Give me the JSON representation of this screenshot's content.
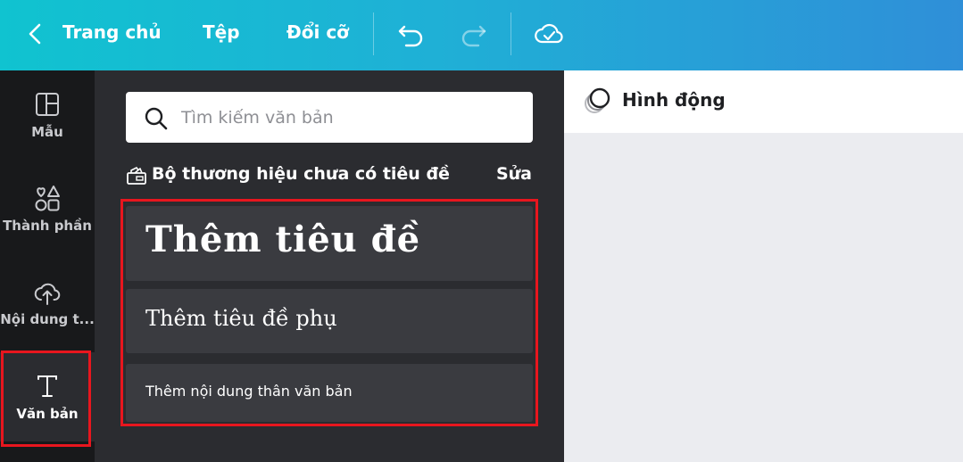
{
  "topbar": {
    "home_label": "Trang chủ",
    "file_label": "Tệp",
    "resize_label": "Đổi cỡ"
  },
  "rail": {
    "items": [
      {
        "label": "Mẫu",
        "icon": "layout-icon"
      },
      {
        "label": "Thành phần",
        "icon": "shapes-icon"
      },
      {
        "label": "Nội dung t...",
        "icon": "upload-cloud-icon"
      },
      {
        "label": "Văn bản",
        "icon": "text-icon",
        "active": true
      }
    ]
  },
  "panel": {
    "search_placeholder": "Tìm kiếm văn bản",
    "brand_label": "Bộ thương hiệu chưa có tiêu đề",
    "edit_label": "Sửa",
    "heading_label": "Thêm tiêu đề",
    "subheading_label": "Thêm tiêu đề phụ",
    "body_label": "Thêm nội dung thân văn bản"
  },
  "right": {
    "animate_label": "Hình động"
  },
  "colors": {
    "highlight": "#e8161e",
    "rail_bg": "#18191b",
    "panel_bg": "#2b2c30",
    "card_bg": "#3a3b40",
    "canvas_bg": "#ebecf0"
  }
}
